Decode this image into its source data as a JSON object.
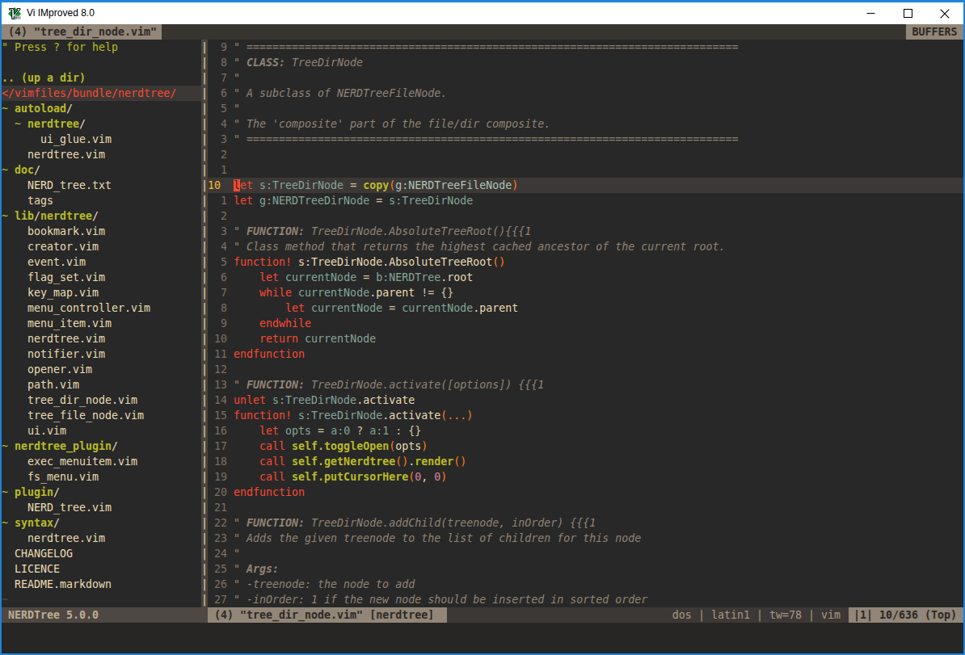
{
  "window": {
    "title": "Vi IMproved 8.0",
    "controls": {
      "minimize": "minimize",
      "maximize": "maximize",
      "close": "close"
    }
  },
  "tabline": {
    "active_tab": "(4) \"tree_dir_node.vim\"",
    "right_label": "BUFFERS"
  },
  "nerdtree": {
    "rows": [
      {
        "name": "tree-help-line",
        "segs": [
          [
            "help",
            "\" Press ? for help"
          ]
        ]
      },
      {
        "name": "tree-blank",
        "segs": []
      },
      {
        "name": "tree-item-up-dir",
        "segs": [
          [
            "up",
            ".. (up a dir)"
          ]
        ]
      },
      {
        "name": "tree-root-path",
        "root": true,
        "segs": [
          [
            "root",
            "</vimfiles/bundle/nerdtree/"
          ]
        ]
      },
      {
        "name": "tree-item-dir-autoload",
        "segs": [
          [
            "g",
            "~ "
          ],
          [
            "dir",
            "autoload"
          ],
          [
            "p",
            "/"
          ]
        ]
      },
      {
        "name": "tree-item-dir-autoload-nerdtree",
        "segs": [
          [
            "p",
            "  "
          ],
          [
            "g",
            "~ "
          ],
          [
            "dir",
            "nerdtree"
          ],
          [
            "p",
            "/"
          ]
        ]
      },
      {
        "name": "tree-item-file-ui-glue",
        "segs": [
          [
            "p",
            "      ui_glue.vim"
          ]
        ]
      },
      {
        "name": "tree-item-file-nerdtree-vim",
        "segs": [
          [
            "p",
            "    nerdtree.vim"
          ]
        ]
      },
      {
        "name": "tree-item-dir-doc",
        "segs": [
          [
            "g",
            "~ "
          ],
          [
            "dir",
            "doc"
          ],
          [
            "p",
            "/"
          ]
        ]
      },
      {
        "name": "tree-item-file-nerd-tree-txt",
        "segs": [
          [
            "p",
            "    NERD_tree.txt"
          ]
        ]
      },
      {
        "name": "tree-item-file-tags",
        "segs": [
          [
            "p",
            "    tags"
          ]
        ]
      },
      {
        "name": "tree-item-dir-lib-nerdtree",
        "segs": [
          [
            "g",
            "~ "
          ],
          [
            "dir",
            "lib"
          ],
          [
            "p",
            "/"
          ],
          [
            "dir",
            "nerdtree"
          ],
          [
            "p",
            "/"
          ]
        ]
      },
      {
        "name": "tree-item-file-bookmark",
        "segs": [
          [
            "p",
            "    bookmark.vim"
          ]
        ]
      },
      {
        "name": "tree-item-file-creator",
        "segs": [
          [
            "p",
            "    creator.vim"
          ]
        ]
      },
      {
        "name": "tree-item-file-event",
        "segs": [
          [
            "p",
            "    event.vim"
          ]
        ]
      },
      {
        "name": "tree-item-file-flag-set",
        "segs": [
          [
            "p",
            "    flag_set.vim"
          ]
        ]
      },
      {
        "name": "tree-item-file-key-map",
        "segs": [
          [
            "p",
            "    key_map.vim"
          ]
        ]
      },
      {
        "name": "tree-item-file-menu-controller",
        "segs": [
          [
            "p",
            "    menu_controller.vim"
          ]
        ]
      },
      {
        "name": "tree-item-file-menu-item",
        "segs": [
          [
            "p",
            "    menu_item.vim"
          ]
        ]
      },
      {
        "name": "tree-item-file-nerdtree-vim-2",
        "segs": [
          [
            "p",
            "    nerdtree.vim"
          ]
        ]
      },
      {
        "name": "tree-item-file-notifier",
        "segs": [
          [
            "p",
            "    notifier.vim"
          ]
        ]
      },
      {
        "name": "tree-item-file-opener",
        "segs": [
          [
            "p",
            "    opener.vim"
          ]
        ]
      },
      {
        "name": "tree-item-file-path",
        "segs": [
          [
            "p",
            "    path.vim"
          ]
        ]
      },
      {
        "name": "tree-item-file-tree-dir-node",
        "segs": [
          [
            "p",
            "    tree_dir_node.vim"
          ]
        ]
      },
      {
        "name": "tree-item-file-tree-file-node",
        "segs": [
          [
            "p",
            "    tree_file_node.vim"
          ]
        ]
      },
      {
        "name": "tree-item-file-ui",
        "segs": [
          [
            "p",
            "    ui.vim"
          ]
        ]
      },
      {
        "name": "tree-item-dir-nerdtree-plugin",
        "segs": [
          [
            "g",
            "~ "
          ],
          [
            "dir",
            "nerdtree_plugin"
          ],
          [
            "p",
            "/"
          ]
        ]
      },
      {
        "name": "tree-item-file-exec-menuitem",
        "segs": [
          [
            "p",
            "    exec_menuitem.vim"
          ]
        ]
      },
      {
        "name": "tree-item-file-fs-menu",
        "segs": [
          [
            "p",
            "    fs_menu.vim"
          ]
        ]
      },
      {
        "name": "tree-item-dir-plugin",
        "segs": [
          [
            "g",
            "~ "
          ],
          [
            "dir",
            "plugin"
          ],
          [
            "p",
            "/"
          ]
        ]
      },
      {
        "name": "tree-item-file-nerd-tree-vim",
        "segs": [
          [
            "p",
            "    NERD_tree.vim"
          ]
        ]
      },
      {
        "name": "tree-item-dir-syntax",
        "segs": [
          [
            "g",
            "~ "
          ],
          [
            "dir",
            "syntax"
          ],
          [
            "p",
            "/"
          ]
        ]
      },
      {
        "name": "tree-item-file-nerdtree-vim-3",
        "segs": [
          [
            "p",
            "    nerdtree.vim"
          ]
        ]
      },
      {
        "name": "tree-item-file-changelog",
        "segs": [
          [
            "p",
            "  CHANGELOG"
          ]
        ]
      },
      {
        "name": "tree-item-file-licence",
        "segs": [
          [
            "p",
            "  LICENCE"
          ]
        ]
      },
      {
        "name": "tree-item-file-readme",
        "segs": [
          [
            "p",
            "  README.markdown"
          ]
        ]
      },
      {
        "name": "tree-nontext-tilde",
        "segs": [
          [
            "nt",
            "~"
          ]
        ]
      }
    ],
    "statusline": "NERDTree 5.0.0"
  },
  "editor": {
    "lines": [
      {
        "num": "9",
        "segs": [
          [
            "c",
            "\" ============================================================================"
          ]
        ]
      },
      {
        "num": "8",
        "segs": [
          [
            "c",
            "\" "
          ],
          [
            "ct",
            "CLASS:"
          ],
          [
            "c",
            " TreeDirNode"
          ]
        ]
      },
      {
        "num": "7",
        "segs": [
          [
            "c",
            "\""
          ]
        ]
      },
      {
        "num": "6",
        "segs": [
          [
            "c",
            "\" A subclass of NERDTreeFileNode."
          ]
        ]
      },
      {
        "num": "5",
        "segs": [
          [
            "c",
            "\""
          ]
        ]
      },
      {
        "num": "4",
        "segs": [
          [
            "c",
            "\" The 'composite' part of the file/dir composite."
          ]
        ]
      },
      {
        "num": "3",
        "segs": [
          [
            "c",
            "\" ============================================================================"
          ]
        ]
      },
      {
        "num": "2",
        "segs": []
      },
      {
        "num": "1",
        "segs": []
      },
      {
        "num": "10",
        "cur": true,
        "segs": [
          [
            "x",
            "l"
          ],
          [
            "k",
            "et"
          ],
          [
            "p",
            " "
          ],
          [
            "i",
            "s:TreeDirNode"
          ],
          [
            "o",
            " = "
          ],
          [
            "f",
            "copy"
          ],
          [
            "d",
            "("
          ],
          [
            "i2",
            "g:NERDTreeFileNode"
          ],
          [
            "d",
            ")"
          ]
        ]
      },
      {
        "num": "1",
        "segs": [
          [
            "k",
            "let"
          ],
          [
            "p",
            " "
          ],
          [
            "i",
            "g:NERDTreeDirNode"
          ],
          [
            "o",
            " = "
          ],
          [
            "i",
            "s:TreeDirNode"
          ]
        ]
      },
      {
        "num": "2",
        "segs": []
      },
      {
        "num": "3",
        "segs": [
          [
            "c",
            "\" "
          ],
          [
            "ct",
            "FUNCTION:"
          ],
          [
            "c",
            " TreeDirNode.AbsoluteTreeRoot(){{{1"
          ]
        ]
      },
      {
        "num": "4",
        "segs": [
          [
            "c",
            "\" Class method that returns the highest cached ancestor of the current root."
          ]
        ]
      },
      {
        "num": "5",
        "segs": [
          [
            "k",
            "function!"
          ],
          [
            "p",
            " s:TreeDirNode.AbsoluteTreeRoot"
          ],
          [
            "d",
            "()"
          ]
        ]
      },
      {
        "num": "6",
        "segs": [
          [
            "p",
            "    "
          ],
          [
            "k",
            "let"
          ],
          [
            "p",
            " "
          ],
          [
            "i",
            "currentNode"
          ],
          [
            "o",
            " = "
          ],
          [
            "i",
            "b:NERDTree"
          ],
          [
            "p",
            ".root"
          ]
        ]
      },
      {
        "num": "7",
        "segs": [
          [
            "p",
            "    "
          ],
          [
            "k",
            "while"
          ],
          [
            "p",
            " "
          ],
          [
            "i",
            "currentNode"
          ],
          [
            "p",
            ".parent"
          ],
          [
            "o",
            " != {}"
          ]
        ]
      },
      {
        "num": "8",
        "segs": [
          [
            "p",
            "        "
          ],
          [
            "k",
            "let"
          ],
          [
            "p",
            " "
          ],
          [
            "i",
            "currentNode"
          ],
          [
            "o",
            " = "
          ],
          [
            "i",
            "currentNode"
          ],
          [
            "p",
            ".parent"
          ]
        ]
      },
      {
        "num": "9",
        "segs": [
          [
            "p",
            "    "
          ],
          [
            "k",
            "endwhile"
          ]
        ]
      },
      {
        "num": "10",
        "segs": [
          [
            "p",
            "    "
          ],
          [
            "k",
            "return"
          ],
          [
            "p",
            " "
          ],
          [
            "i",
            "currentNode"
          ]
        ]
      },
      {
        "num": "11",
        "segs": [
          [
            "k",
            "endfunction"
          ]
        ]
      },
      {
        "num": "12",
        "segs": []
      },
      {
        "num": "13",
        "segs": [
          [
            "c",
            "\" "
          ],
          [
            "ct",
            "FUNCTION:"
          ],
          [
            "c",
            " TreeDirNode.activate([options]) {{{1"
          ]
        ]
      },
      {
        "num": "14",
        "segs": [
          [
            "k",
            "unlet"
          ],
          [
            "p",
            " "
          ],
          [
            "i",
            "s:TreeDirNode"
          ],
          [
            "p",
            ".activate"
          ]
        ]
      },
      {
        "num": "15",
        "segs": [
          [
            "k",
            "function!"
          ],
          [
            "p",
            " "
          ],
          [
            "i",
            "s:TreeDirNode"
          ],
          [
            "p",
            ".activate"
          ],
          [
            "d",
            "(...)"
          ]
        ]
      },
      {
        "num": "16",
        "segs": [
          [
            "p",
            "    "
          ],
          [
            "k",
            "let"
          ],
          [
            "p",
            " "
          ],
          [
            "i",
            "opts"
          ],
          [
            "o",
            " = "
          ],
          [
            "i",
            "a:0"
          ],
          [
            "o",
            " ? "
          ],
          [
            "i",
            "a:1"
          ],
          [
            "o",
            " : {}"
          ]
        ]
      },
      {
        "num": "17",
        "segs": [
          [
            "p",
            "    "
          ],
          [
            "k",
            "call"
          ],
          [
            "p",
            " "
          ],
          [
            "f",
            "self.toggleOpen"
          ],
          [
            "d",
            "("
          ],
          [
            "p",
            "opts"
          ],
          [
            "d",
            ")"
          ]
        ]
      },
      {
        "num": "18",
        "segs": [
          [
            "p",
            "    "
          ],
          [
            "k",
            "call"
          ],
          [
            "p",
            " "
          ],
          [
            "f",
            "self.getNerdtree"
          ],
          [
            "d",
            "()"
          ],
          [
            "p",
            "."
          ],
          [
            "f",
            "render"
          ],
          [
            "d",
            "()"
          ]
        ]
      },
      {
        "num": "19",
        "segs": [
          [
            "p",
            "    "
          ],
          [
            "k",
            "call"
          ],
          [
            "p",
            " "
          ],
          [
            "f",
            "self.putCursorHere"
          ],
          [
            "d",
            "("
          ],
          [
            "n",
            "0"
          ],
          [
            "p",
            ", "
          ],
          [
            "n",
            "0"
          ],
          [
            "d",
            ")"
          ]
        ]
      },
      {
        "num": "20",
        "segs": [
          [
            "k",
            "endfunction"
          ]
        ]
      },
      {
        "num": "21",
        "segs": []
      },
      {
        "num": "22",
        "segs": [
          [
            "c",
            "\" "
          ],
          [
            "ct",
            "FUNCTION:"
          ],
          [
            "c",
            " TreeDirNode.addChild(treenode, inOrder) {{{1"
          ]
        ]
      },
      {
        "num": "23",
        "segs": [
          [
            "c",
            "\" Adds the given treenode to the list of children for this node"
          ]
        ]
      },
      {
        "num": "24",
        "segs": [
          [
            "c",
            "\""
          ]
        ]
      },
      {
        "num": "25",
        "segs": [
          [
            "c",
            "\" "
          ],
          [
            "ct",
            "Args:"
          ]
        ]
      },
      {
        "num": "26",
        "segs": [
          [
            "c",
            "\" -treenode: the node to add"
          ]
        ]
      },
      {
        "num": "27",
        "segs": [
          [
            "c",
            "\" -inOrder: 1 if the new node should be inserted in sorted order"
          ]
        ]
      }
    ]
  },
  "statusline": {
    "left": "(4) \"tree_dir_node.vim\" [nerdtree]",
    "middle": "dos | latin1 | tw=78 | vim",
    "right": "|1| 10/636 (Top)"
  },
  "colors": {
    "window_border": "#1e83d9",
    "titlebar_bg": "#ffffff",
    "titlebar_fg": "#000000",
    "editor_bg": "#282828",
    "editor_fg": "#ebdbb2",
    "cursorline_bg": "#3c3836",
    "tab_selected_bg": "#918678",
    "tab_fill_bg": "#38342f",
    "statusline_nc_bg": "#4e4742",
    "statusline_mid_fg": "#a89984",
    "keyword_red": "#fb4934",
    "identifier_blue": "#83a598",
    "function_green": "#b8bb26",
    "delimiter_orange": "#fe8019",
    "number_purple": "#d3869b",
    "comment_gray": "#928374",
    "line_number_gray": "#7c6f64",
    "cursor_line_number_yellow": "#fabd2f"
  },
  "separator": {
    "char": "|",
    "rows": 37
  }
}
